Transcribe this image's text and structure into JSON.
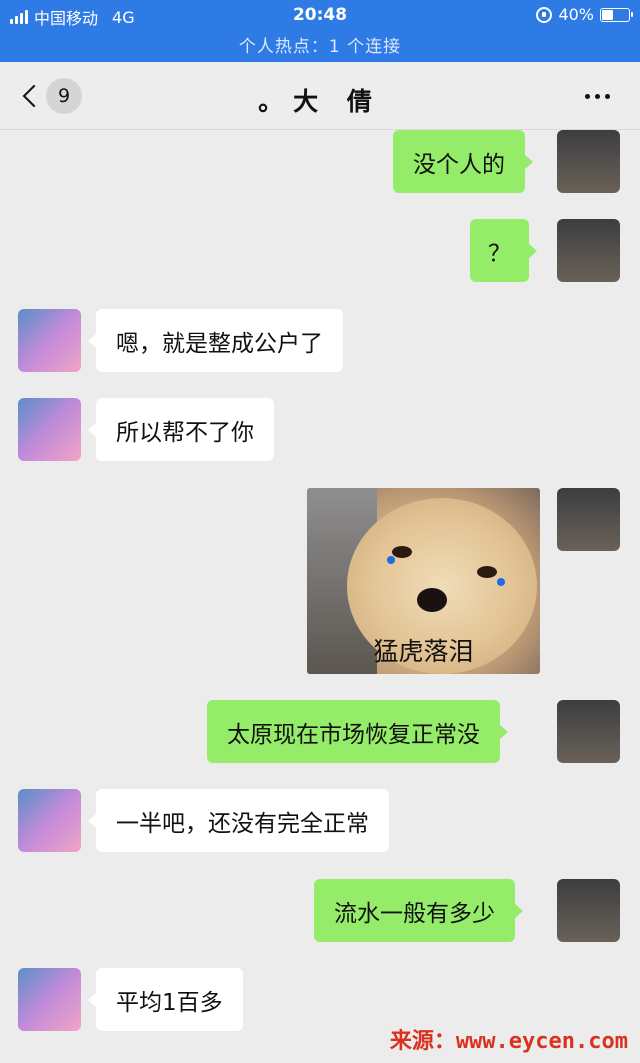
{
  "status_bar": {
    "carrier": "中国移动",
    "network": "4G",
    "time": "20:48",
    "battery": "40%",
    "battery_level": 0.4
  },
  "hotspot_banner": "个人热点：1 个连接",
  "nav": {
    "unread_count": "9",
    "title": "。大 倩"
  },
  "messages": [
    {
      "from": "me",
      "text": "没个人的"
    },
    {
      "from": "me",
      "text": "？"
    },
    {
      "from": "her",
      "text": "嗯，就是整成公户了"
    },
    {
      "from": "her",
      "text": "所以帮不了你"
    },
    {
      "from": "me",
      "type": "sticker",
      "text": "猛虎落泪"
    },
    {
      "from": "me",
      "text": "太原现在市场恢复正常没"
    },
    {
      "from": "her",
      "text": "一半吧，还没有完全正常"
    },
    {
      "from": "me",
      "text": "流水一般有多少"
    },
    {
      "from": "her",
      "text": "平均1百多"
    }
  ],
  "watermark": "来源：www.eycen.com",
  "colors": {
    "status_bar": "#2f7be6",
    "sent_bubble": "#95ec69",
    "received_bubble": "#ffffff",
    "chat_background": "#ececec"
  }
}
